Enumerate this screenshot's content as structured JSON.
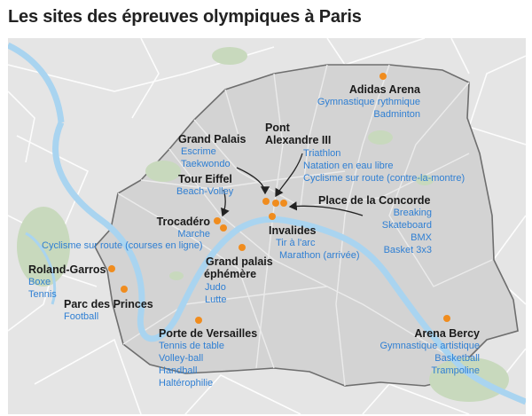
{
  "title": "Les sites des épreuves olympiques à Paris",
  "colors": {
    "water": "#a9d4f0",
    "city": "#d4d4d4",
    "park": "#c8d9c0",
    "marker": "#f08c1e",
    "venue_text": "#1a1a1a",
    "sport_text": "#2f7fd3"
  },
  "venues": {
    "adidas": {
      "name": "Adidas Arena",
      "sports": [
        "Gymnastique rythmique",
        "Badminton"
      ]
    },
    "grandpalais": {
      "name": "Grand Palais",
      "sports": [
        "Escrime",
        "Taekwondo"
      ]
    },
    "pontalex": {
      "name_line1": "Pont",
      "name_line2": "Alexandre III",
      "sports": [
        "Triathlon",
        "Natation en eau libre",
        "Cyclisme sur route (contre-la-montre)"
      ]
    },
    "toureiffel": {
      "name": "Tour Eiffel",
      "sports": [
        "Beach-Volley"
      ]
    },
    "concorde": {
      "name": "Place de la Concorde",
      "sports": [
        "Breaking",
        "Skateboard",
        "BMX",
        "Basket 3x3"
      ]
    },
    "trocadero": {
      "name": "Trocadéro",
      "sports": [
        "Marche",
        "Cyclisme sur route (courses en ligne)"
      ]
    },
    "invalides": {
      "name": "Invalides",
      "sports": [
        "Tir à l'arc",
        "Marathon (arrivée)"
      ]
    },
    "gpephemere": {
      "name_line1": "Grand palais",
      "name_line2": "éphémère",
      "sports": [
        "Judo",
        "Lutte"
      ]
    },
    "rolandgarros": {
      "name": "Roland-Garros",
      "sports": [
        "Boxe",
        "Tennis"
      ]
    },
    "parcprinces": {
      "name": "Parc des Princes",
      "sports": [
        "Football"
      ]
    },
    "versailles": {
      "name": "Porte de Versailles",
      "sports": [
        "Tennis de table",
        "Volley-ball",
        "Handball",
        "Haltérophilie"
      ]
    },
    "bercy": {
      "name": "Arena Bercy",
      "sports": [
        "Gymnastique artistique",
        "Basketball",
        "Trampoline"
      ]
    }
  }
}
